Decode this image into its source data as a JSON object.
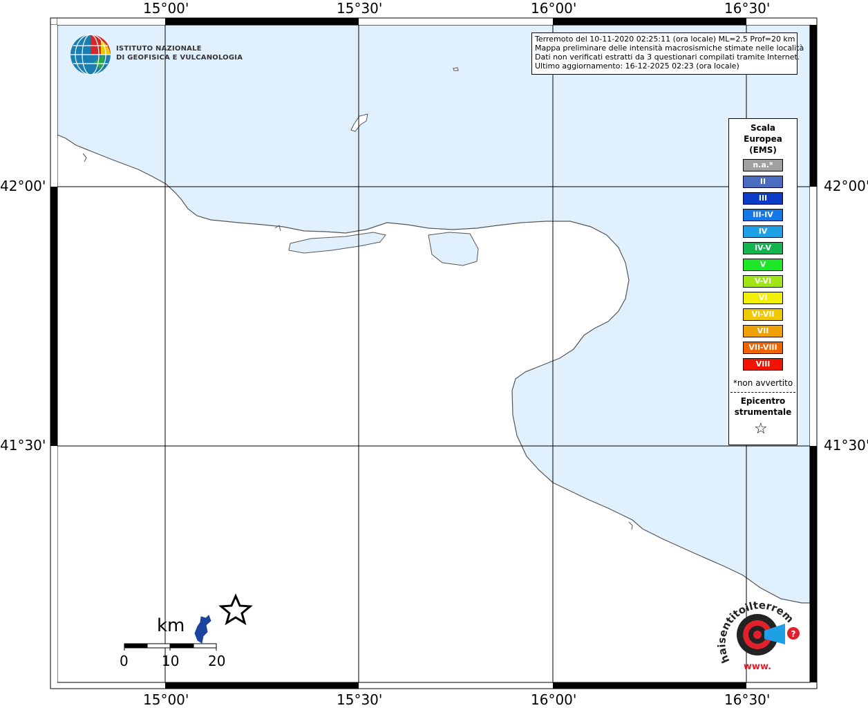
{
  "map": {
    "lon_labels": [
      "15°00'",
      "15°30'",
      "16°00'",
      "16°30'"
    ],
    "lat_labels": [
      "42°00'",
      "41°30'"
    ],
    "colors": {
      "sea": "#e0f1fd",
      "land": "#ffffff",
      "coast": "#555555",
      "grid": "#000000",
      "lake": "#1a44a0"
    }
  },
  "info": {
    "line1": "Terremoto del 10-11-2020 02:25:11 (ora locale) ML=2.5 Prof=20 km",
    "line2": "Mappa preliminare delle intensità macrosismiche stimate nelle località",
    "line3": "Dati non verificati estratti da 3 questionari compilati tramite Internet.",
    "line4": "Ultimo aggiornamento: 16-12-2025 02:23 (ora locale)"
  },
  "legend": {
    "title": "Scala\nEuropea\n(EMS)",
    "classes": [
      {
        "label": "n.a.*",
        "color": "#a0a0a0"
      },
      {
        "label": "II",
        "color": "#4b6cbf"
      },
      {
        "label": "III",
        "color": "#0a3cc8"
      },
      {
        "label": "III-IV",
        "color": "#1478e6"
      },
      {
        "label": "IV",
        "color": "#1ea0e6"
      },
      {
        "label": "IV-V",
        "color": "#14b450"
      },
      {
        "label": "V",
        "color": "#1ee628"
      },
      {
        "label": "V-VI",
        "color": "#a0e614"
      },
      {
        "label": "VI",
        "color": "#f0f000"
      },
      {
        "label": "VI-VII",
        "color": "#f0c800"
      },
      {
        "label": "VII",
        "color": "#f0a000"
      },
      {
        "label": "VII-VIII",
        "color": "#f06400"
      },
      {
        "label": "VIII",
        "color": "#f01400"
      }
    ],
    "na_note": "*non avvertito",
    "epicenter_title": "Epicentro\nstrumentale",
    "epicenter_symbol": "☆"
  },
  "ingv": {
    "line1": "ISTITUTO NAZIONALE",
    "line2": "DI GEOFISICA E VULCANOLOGIA"
  },
  "scalebar": {
    "unit": "km",
    "ticks": [
      "0",
      "10",
      "20"
    ]
  },
  "hai_logo": {
    "text": "haisentitoilterremoto.it",
    "www": "www."
  }
}
